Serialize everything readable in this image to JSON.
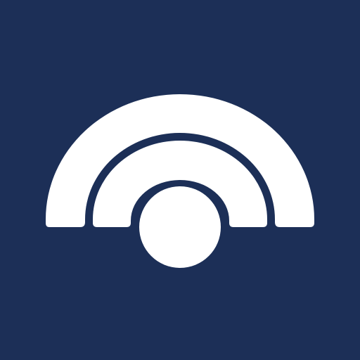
{
  "app_icon": {
    "icon_name": "signal-arcs-logo-icon",
    "colors": {
      "background": "#1c2f57",
      "foreground": "#ffffff"
    }
  }
}
